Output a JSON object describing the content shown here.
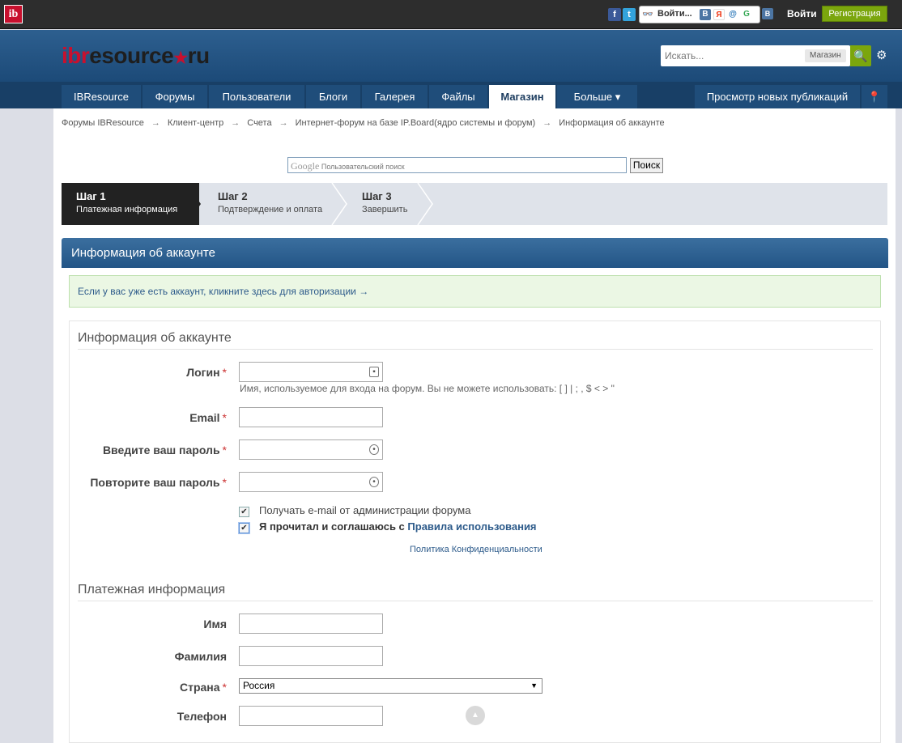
{
  "topbar": {
    "logo_text": "ib",
    "facebook": "f",
    "twitter": "t",
    "loginza_glyph": "👓",
    "loginza_label": "Войти...",
    "loginza_services": [
      "В",
      "Я",
      "@",
      "G"
    ],
    "vk": "B",
    "login_label": "Войти",
    "register_label": "Регистрация"
  },
  "header": {
    "logo_part1": "ibr",
    "logo_part2": "esource",
    "logo_star": "★",
    "logo_part3": "ru",
    "search_placeholder": "Искать...",
    "search_scope": "Магазин",
    "search_go_icon": "🔍",
    "settings_icon": "⚙"
  },
  "nav": {
    "items": [
      "IBResource",
      "Форумы",
      "Пользователи",
      "Блоги",
      "Галерея",
      "Файлы",
      "Магазин",
      "Больше ▾"
    ],
    "active": "Магазин",
    "new_content": "Просмотр новых публикаций",
    "pin_icon": "📍"
  },
  "breadcrumb": {
    "items": [
      "Форумы IBResource",
      "Клиент-центр",
      "Счета",
      "Интернет-форум на базе IP.Board(ядро системы и форум)",
      "Информация об аккаунте"
    ],
    "separator": "→"
  },
  "google_search": {
    "brand": "Google",
    "placeholder": "Пользовательский поиск",
    "button": "Поиск"
  },
  "steps": [
    {
      "title": "Шаг 1",
      "subtitle": "Платежная информация"
    },
    {
      "title": "Шаг 2",
      "subtitle": "Подтверждение и оплата"
    },
    {
      "title": "Шаг 3",
      "subtitle": "Завершить"
    }
  ],
  "account": {
    "header": "Информация об аккаунте",
    "login_notice": "Если у вас уже есть аккаунт, кликните здесь для авторизации →",
    "section_title": "Информация об аккаунте",
    "fields": {
      "login": "Логин",
      "login_hint": "Имя, используемое для входа на форум. Вы не можете использовать: [ ] | ; , $ < > \"",
      "email": "Email",
      "password": "Введите ваш пароль",
      "password_repeat": "Повторите ваш пароль"
    },
    "required_mark": "*",
    "checkbox_admin_mail": "Получать e-mail от администрации форума",
    "checkbox_terms_prefix": "Я прочитал и соглашаюсь с",
    "checkbox_terms_link": "Правила использования",
    "privacy_link": "Политика Конфиденциальности"
  },
  "billing": {
    "section_title": "Платежная информация",
    "first_name": "Имя",
    "last_name": "Фамилия",
    "country": "Страна",
    "country_value": "Россия",
    "phone": "Телефон"
  }
}
